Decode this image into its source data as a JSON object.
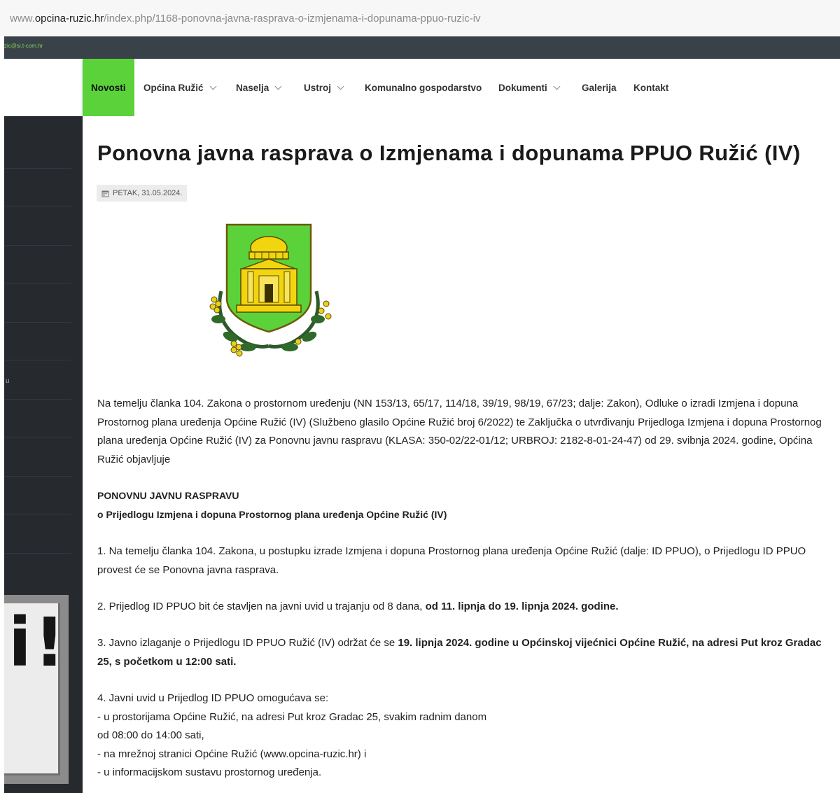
{
  "browser": {
    "url_prefix": "www.",
    "url_domain": "opcina-ruzic.hr",
    "url_path": "/index.php/1168-ponovna-javna-rasprava-o-izmjenama-i-dopunama-ppuo-ruzic-iv"
  },
  "topbar": {
    "email": "zic@si.t-com.hr"
  },
  "nav": {
    "items": [
      {
        "label": "Novosti",
        "active": true,
        "dropdown": false
      },
      {
        "label": "Općina Ružić",
        "dropdown": true
      },
      {
        "label": "Naselja",
        "dropdown": true
      },
      {
        "label": "Ustroj",
        "dropdown": true
      },
      {
        "label": "Komunalno gospodarstvo",
        "dropdown": false
      },
      {
        "label": "Dokumenti",
        "dropdown": true
      },
      {
        "label": "Galerija",
        "dropdown": false
      },
      {
        "label": "Kontakt",
        "dropdown": false
      }
    ]
  },
  "sidebar": {
    "mark": "u"
  },
  "promo": {
    "text": "i!"
  },
  "article": {
    "title": "Ponovna javna rasprava o Izmjenama i dopunama PPUO Ružić (IV)",
    "date": "PETAK, 31.05.2024.",
    "date_icon": "calendar-icon",
    "image": "coat-of-arms-ruzic",
    "intro": "Na temelju članka 104. Zakona o prostornom uređenju (NN 153/13, 65/17, 114/18, 39/19, 98/19, 67/23; dalje: Zakon), Odluke o izradi Izmjena i dopuna Prostornog plana uređenja Općine Ružić (IV) (Službeno glasilo Općine Ružić broj 6/2022) te Zaključka o utvrđivanju Prijedloga Izmjena i dopuna Prostornog plana uređenja Općine Ružić (IV) za Ponovnu javnu raspravu (KLASA: 350-02/22-01/12; URBROJ: 2182-8-01-24-47) od 29. svibnja 2024. godine, Općina Ružić objavljuje",
    "heading1": "PONOVNU JAVNU RASPRAVU",
    "heading2": "o Prijedlogu Izmjena i dopuna Prostornog plana uređenja Općine Ružić (IV)",
    "p1": "1. Na temelju članka 104. Zakona, u postupku izrade Izmjena i dopuna Prostornog plana uređenja Općine Ružić (dalje: ID PPUO), o Prijedlogu ID PPUO provest će se Ponovna javna rasprava.",
    "p2_plain": "2. Prijedlog ID PPUO bit će stavljen na javni uvid u trajanju od 8 dana, ",
    "p2_bold": "od 11. lipnja do 19. lipnja 2024. godine.",
    "p3_plain": "3. Javno izlaganje o Prijedlogu ID PPUO Ružić (IV) održat će se ",
    "p3_bold": "19. lipnja 2024. godine u Općinskoj vijećnici Općine Ružić, na adresi Put kroz Gradac 25, s početkom u 12:00 sati.",
    "p4_lines": [
      "4. Javni uvid u Prijedlog ID PPUO omogućava se:",
      "- u prostorijama Općine Ružić, na adresi Put kroz Gradac 25, svakim radnim danom",
      "od 08:00 do 14:00 sati,",
      "- na mrežnoj stranici Općine Ružić (www.opcina-ruzic.hr) i",
      "- u informacijskom sustavu prostornog uređenja."
    ]
  },
  "colors": {
    "nav_active": "#5bd23a",
    "topstrip": "#3a4249",
    "sidebar": "#262a2e",
    "crest_green": "#5bd23a",
    "crest_gold": "#f2d50f"
  }
}
